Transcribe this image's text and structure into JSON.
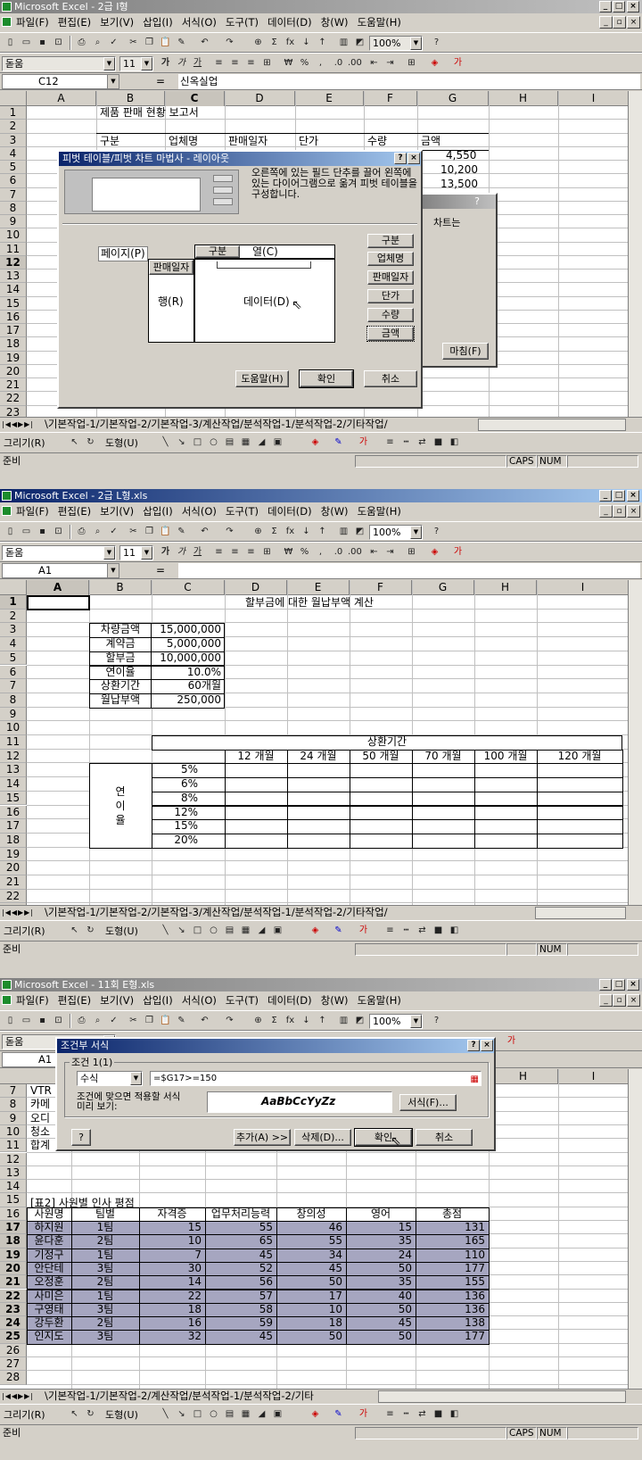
{
  "win1": {
    "title": "Microsoft Excel - 2급 I형",
    "menu": [
      "파일(F)",
      "편집(E)",
      "보기(V)",
      "삽입(I)",
      "서식(O)",
      "도구(T)",
      "데이터(D)",
      "창(W)",
      "도움말(H)"
    ],
    "font": "돋움",
    "size": "11",
    "zoom": "100%",
    "namebox": "C12",
    "formula": "신옥실업",
    "cols": [
      "A",
      "B",
      "C",
      "D",
      "E",
      "F",
      "G",
      "H",
      "I"
    ],
    "rows": [
      "1",
      "2",
      "3",
      "4",
      "5",
      "6",
      "7",
      "8",
      "9",
      "10",
      "11",
      "12",
      "13",
      "14",
      "15",
      "16",
      "17",
      "18",
      "19",
      "20",
      "21",
      "22",
      "23"
    ],
    "cells": {
      "b1": "제품 판매 현황 보고서",
      "b3": "구분",
      "c3": "업체명",
      "d3": "판매일자",
      "e3": "단가",
      "f3": "수량",
      "g3": "금액",
      "g4": "4,550",
      "g5": "10,200",
      "g6": "13,500"
    },
    "tabs": "\\기본작업-1/기본작업-2/기본작업-3/계산작업/분석작업-1/분석작업-2/기타작업/",
    "status": "준비",
    "caps": "CAPS",
    "num": "NUM",
    "draw": {
      "draw_label": "그리기(R)",
      "autoshape_label": "도형(U)"
    },
    "dialog": {
      "title": "피벗 테이블/피벗 차트 마법사 - 레이아웃",
      "help_text": "오른쪽에 있는 필드 단추를 끌어 왼쪽에 있는 다이어그램으로 옮겨 피벗 테이블을 구성합니다.",
      "page_label": "페이지(P)",
      "row_label": "행(R)",
      "col_label": "열(C)",
      "data_label": "데이터(D)",
      "row_field": "판매일자",
      "col_field": "구분",
      "fields": [
        "구분",
        "업체명",
        "판매일자",
        "단가",
        "수량",
        "금액"
      ],
      "help_btn": "도움말(H)",
      "ok_btn": "확인",
      "cancel_btn": "취소"
    },
    "behind_dialog": {
      "text": "차트는",
      "finish_btn": "마침(F)"
    }
  },
  "win2": {
    "title": "Microsoft Excel - 2급 L형.xls",
    "menu": [
      "파일(F)",
      "편집(E)",
      "보기(V)",
      "삽입(I)",
      "서식(O)",
      "도구(T)",
      "데이터(D)",
      "창(W)",
      "도움말(H)"
    ],
    "font": "돋움",
    "size": "11",
    "zoom": "100%",
    "namebox": "A1",
    "formula": "",
    "cols": [
      "A",
      "B",
      "C",
      "D",
      "E",
      "F",
      "G",
      "H",
      "I"
    ],
    "rows": [
      "1",
      "2",
      "3",
      "4",
      "5",
      "6",
      "7",
      "8",
      "9",
      "10",
      "11",
      "12",
      "13",
      "14",
      "15",
      "16",
      "17",
      "18",
      "19",
      "20",
      "21",
      "22",
      "23"
    ],
    "title_cell": "할부금에 대한 월납부액 계산",
    "labels": [
      "차량금액",
      "계약금",
      "할부금",
      "연이율",
      "상환기간",
      "월납부액"
    ],
    "values": [
      "15,000,000",
      "5,000,000",
      "10,000,000",
      "10.0%",
      "60개월",
      "250,000"
    ],
    "period_header": "상환기간",
    "periods": [
      "12 개월",
      "24 개월",
      "50 개월",
      "70 개월",
      "100 개월",
      "120 개월"
    ],
    "rate_label": "연\n이\n율",
    "rates": [
      "5%",
      "6%",
      "8%",
      "12%",
      "15%",
      "20%"
    ],
    "tabs": "\\기본작업-1/기본작업-2/기본작업-3/계산작업/분석작업-1/분석작업-2/기타작업/",
    "status": "준비",
    "num": "NUM",
    "draw": {
      "draw_label": "그리기(R)",
      "autoshape_label": "도형(U)"
    }
  },
  "win3": {
    "title": "Microsoft Excel - 11회 E형.xls",
    "menu": [
      "파일(F)",
      "편집(E)",
      "보기(V)",
      "삽입(I)",
      "서식(O)",
      "도구(T)",
      "데이터(D)",
      "창(W)",
      "도움말(H)"
    ],
    "font": "돋움",
    "zoom": "100%",
    "namebox": "A1",
    "rows": [
      "7",
      "8",
      "9",
      "10",
      "11",
      "12",
      "13",
      "14",
      "15",
      "16",
      "17",
      "18",
      "19",
      "20",
      "21",
      "22",
      "23",
      "24",
      "25",
      "26",
      "27",
      "28"
    ],
    "left_cells": [
      "VTR",
      "카메",
      "오디",
      "청소",
      "합계"
    ],
    "table_title": "[표2]  사원별 인사 평점",
    "headers": [
      "사원명",
      "팀별",
      "자격증",
      "업무처리능력",
      "창의성",
      "영어",
      "총점"
    ],
    "data": [
      [
        "하지원",
        "1팀",
        "15",
        "55",
        "46",
        "15",
        "131"
      ],
      [
        "윤다훈",
        "2팀",
        "10",
        "65",
        "55",
        "35",
        "165"
      ],
      [
        "기정구",
        "1팀",
        "7",
        "45",
        "34",
        "24",
        "110"
      ],
      [
        "안단테",
        "3팀",
        "30",
        "52",
        "45",
        "50",
        "177"
      ],
      [
        "오정훈",
        "2팀",
        "14",
        "56",
        "50",
        "35",
        "155"
      ],
      [
        "사미은",
        "1팀",
        "22",
        "57",
        "17",
        "40",
        "136"
      ],
      [
        "구영태",
        "3팀",
        "18",
        "58",
        "10",
        "50",
        "136"
      ],
      [
        "강두환",
        "2팀",
        "16",
        "59",
        "18",
        "45",
        "138"
      ],
      [
        "인지도",
        "3팀",
        "32",
        "45",
        "50",
        "50",
        "177"
      ]
    ],
    "tabs": "\\기본작업-1/기본작업-2/계산작업/분석작업-1/분석작업-2/기타",
    "status": "준비",
    "caps": "CAPS",
    "num": "NUM",
    "draw": {
      "draw_label": "그리기(R)",
      "autoshape_label": "도형(U)"
    },
    "dialog": {
      "title": "조건부 서식",
      "group": "조건 1(1)",
      "type": "수식",
      "formula": "=$G17>=150",
      "preview_label": "조건에 맞으면 적용할 서식\n미리 보기:",
      "preview": "AaBbCcYyZz",
      "format_btn": "서식(F)...",
      "add_btn": "추가(A) >>",
      "delete_btn": "삭제(D)...",
      "ok_btn": "확인",
      "cancel_btn": "취소",
      "help_btn": "?"
    }
  }
}
